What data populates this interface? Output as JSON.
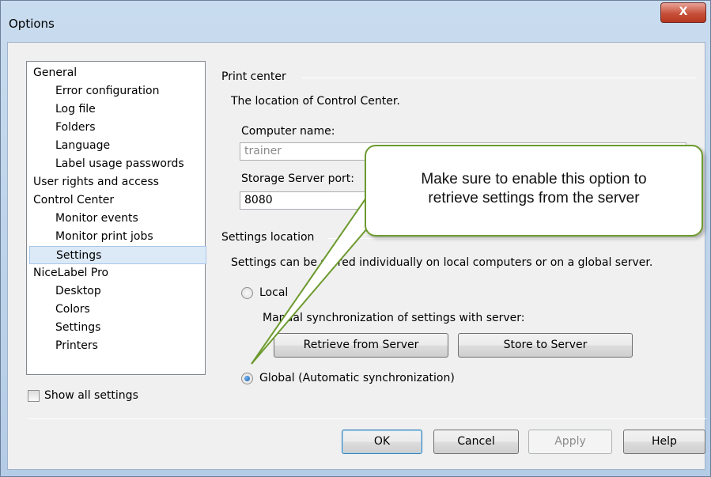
{
  "window": {
    "title": "Options",
    "close_glyph": "X"
  },
  "tree": {
    "items": [
      {
        "label": "General",
        "level": 0
      },
      {
        "label": "Error configuration",
        "level": 1
      },
      {
        "label": "Log file",
        "level": 1
      },
      {
        "label": "Folders",
        "level": 1
      },
      {
        "label": "Language",
        "level": 1
      },
      {
        "label": "Label usage passwords",
        "level": 1
      },
      {
        "label": "User rights and access",
        "level": 0
      },
      {
        "label": "Control Center",
        "level": 0
      },
      {
        "label": "Monitor events",
        "level": 1
      },
      {
        "label": "Monitor print jobs",
        "level": 1
      },
      {
        "label": "Settings",
        "level": 1,
        "selected": true
      },
      {
        "label": "NiceLabel Pro",
        "level": 0
      },
      {
        "label": "Desktop",
        "level": 1
      },
      {
        "label": "Colors",
        "level": 1
      },
      {
        "label": "Settings",
        "level": 1
      },
      {
        "label": "Printers",
        "level": 1
      }
    ]
  },
  "show_all": {
    "label": "Show all settings",
    "checked": false
  },
  "print_center": {
    "group_title": "Print center",
    "description": "The location of Control Center.",
    "computer_name_label": "Computer name:",
    "computer_name_value": "trainer",
    "port_label": "Storage Server port:",
    "port_value": "8080"
  },
  "settings_location": {
    "group_title": "Settings location",
    "description": "Settings can be stored individually on local computers or on a global server.",
    "local_label": "Local",
    "manual_sync_label": "Manual synchronization of settings with server:",
    "retrieve_button": "Retrieve from Server",
    "store_button": "Store to Server",
    "global_label": "Global (Automatic synchronization)",
    "selected": "global"
  },
  "footer": {
    "ok": "OK",
    "cancel": "Cancel",
    "apply": "Apply",
    "help": "Help"
  },
  "callout": {
    "line1": "Make sure to enable this option to",
    "line2": "retrieve settings from the server",
    "border_color": "#6d9a2f"
  }
}
